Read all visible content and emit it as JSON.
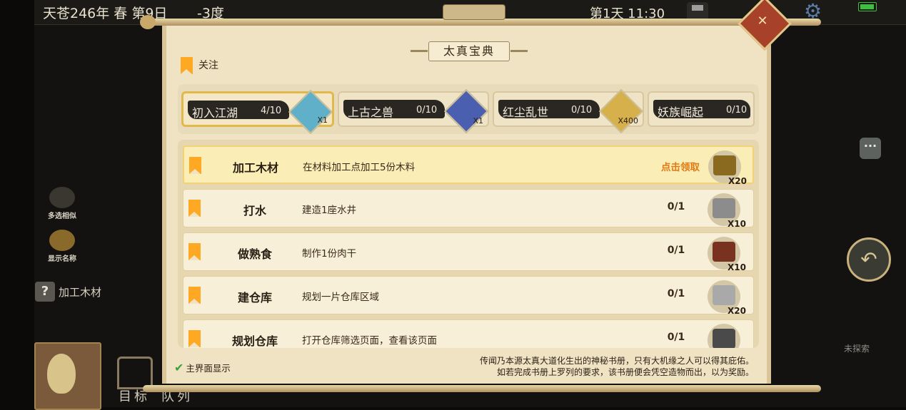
{
  "hud": {
    "date": "天苍246年 春 第9日",
    "temperature": "-3度",
    "time": "第1天 11:30"
  },
  "left_panel": {
    "multi_select_label": "多选相似",
    "show_names_label": "显示名称",
    "help_mark": "?",
    "current_task_label": "加工木材",
    "bottom_tabs": [
      "目标",
      "队列"
    ]
  },
  "right_panel": {
    "unexplored_label": "未探索"
  },
  "dialog": {
    "title": "太真宝典",
    "follow_label": "关注",
    "categories": [
      {
        "name": "初入江湖",
        "progress": "4/10",
        "reward_qty": "X1",
        "active": true
      },
      {
        "name": "上古之兽",
        "progress": "0/10",
        "reward_qty": "X1",
        "active": false
      },
      {
        "name": "红尘乱世",
        "progress": "0/10",
        "reward_qty": "X400",
        "active": false
      },
      {
        "name": "妖族崛起",
        "progress": "0/10",
        "reward_qty": "",
        "active": false
      }
    ],
    "tasks": [
      {
        "title": "加工木材",
        "desc": "在材料加工点加工5份木料",
        "status": "点击领取",
        "reward_qty": "X20",
        "claimable": true,
        "reward_icon": "wood-icon"
      },
      {
        "title": "打水",
        "desc": "建造1座水井",
        "status": "0/1",
        "reward_qty": "X10",
        "claimable": false,
        "reward_icon": "stone-icon"
      },
      {
        "title": "做熟食",
        "desc": "制作1份肉干",
        "status": "0/1",
        "reward_qty": "X10",
        "claimable": false,
        "reward_icon": "jerky-icon"
      },
      {
        "title": "建仓库",
        "desc": "规划一片仓库区域",
        "status": "0/1",
        "reward_qty": "X20",
        "claimable": false,
        "reward_icon": "stone-brick-icon"
      },
      {
        "title": "规划仓库",
        "desc": "打开仓库筛选页面，查看该页面",
        "status": "0/1",
        "reward_qty": "",
        "claimable": false,
        "reward_icon": "chest-icon"
      }
    ],
    "show_on_main_label": "主界面显示",
    "note_line1": "传闻乃本源太真大道化生出的神秘书册，只有大机缘之人可以得其庇佑。",
    "note_line2": "如若完成书册上罗列的要求，该书册便会凭空造物而出，以为奖励。"
  },
  "colors": {
    "accent_orange": "#ffa824",
    "claim_text": "#e07a12",
    "parchment": "#efe3c3"
  }
}
